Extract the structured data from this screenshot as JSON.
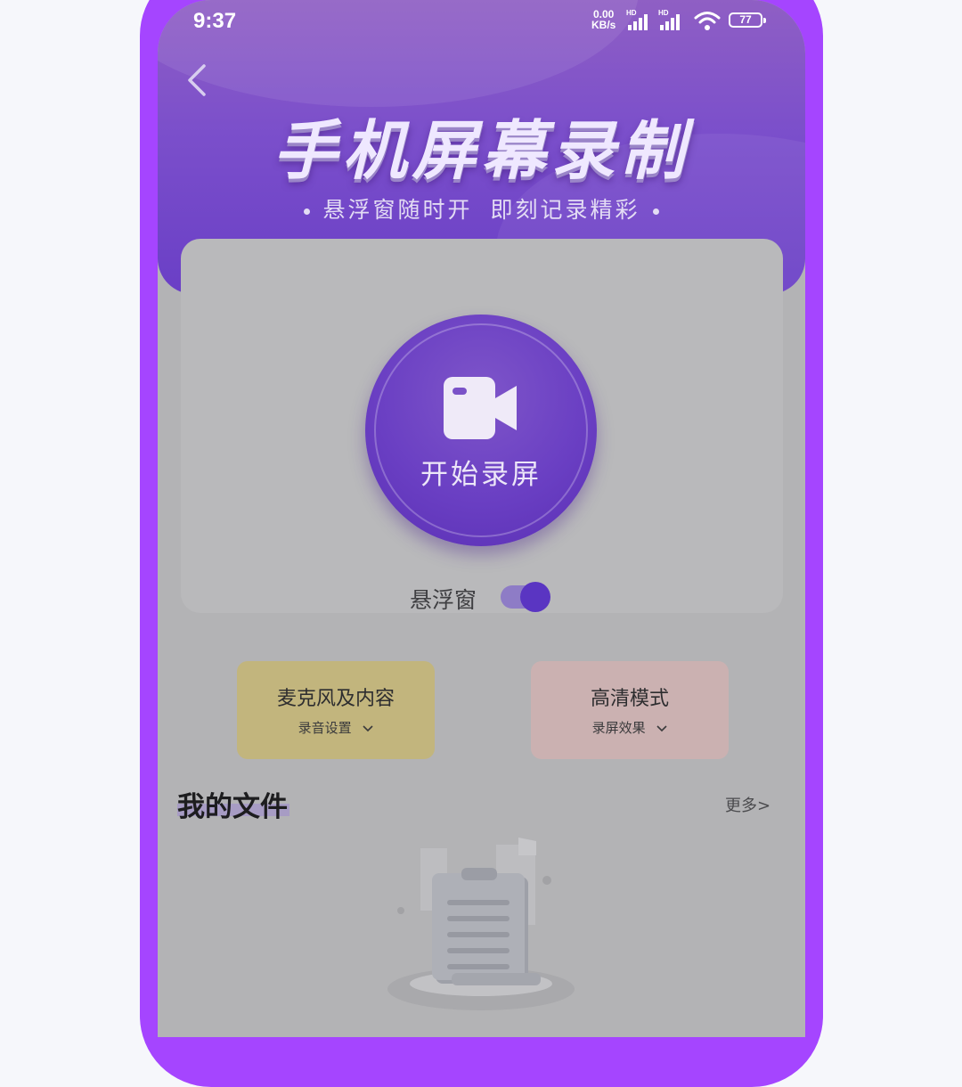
{
  "status_bar": {
    "time": "9:37",
    "net_speed_value": "0.00",
    "net_speed_unit": "KB/s",
    "sim1_label": "HD",
    "sim2_label": "HD",
    "battery": "77"
  },
  "header": {
    "back_icon": "chevron-left-icon",
    "title": "手机屏幕录制",
    "subtitle_left": "悬浮窗随时开",
    "subtitle_right": "即刻记录精彩"
  },
  "record": {
    "icon": "video-camera-icon",
    "label": "开始录屏"
  },
  "floating_window": {
    "label": "悬浮窗",
    "enabled": true
  },
  "options": [
    {
      "title": "麦克风及内容",
      "subtitle": "录音设置"
    },
    {
      "title": "高清模式",
      "subtitle": "录屏效果"
    }
  ],
  "files": {
    "title": "我的文件",
    "more": "更多>"
  },
  "colors": {
    "frame": "#a545ff",
    "header": "#7b4fcb",
    "accent": "#5a35c2",
    "mic_card": "#c2b57d",
    "hd_card": "#cbb1b1"
  }
}
